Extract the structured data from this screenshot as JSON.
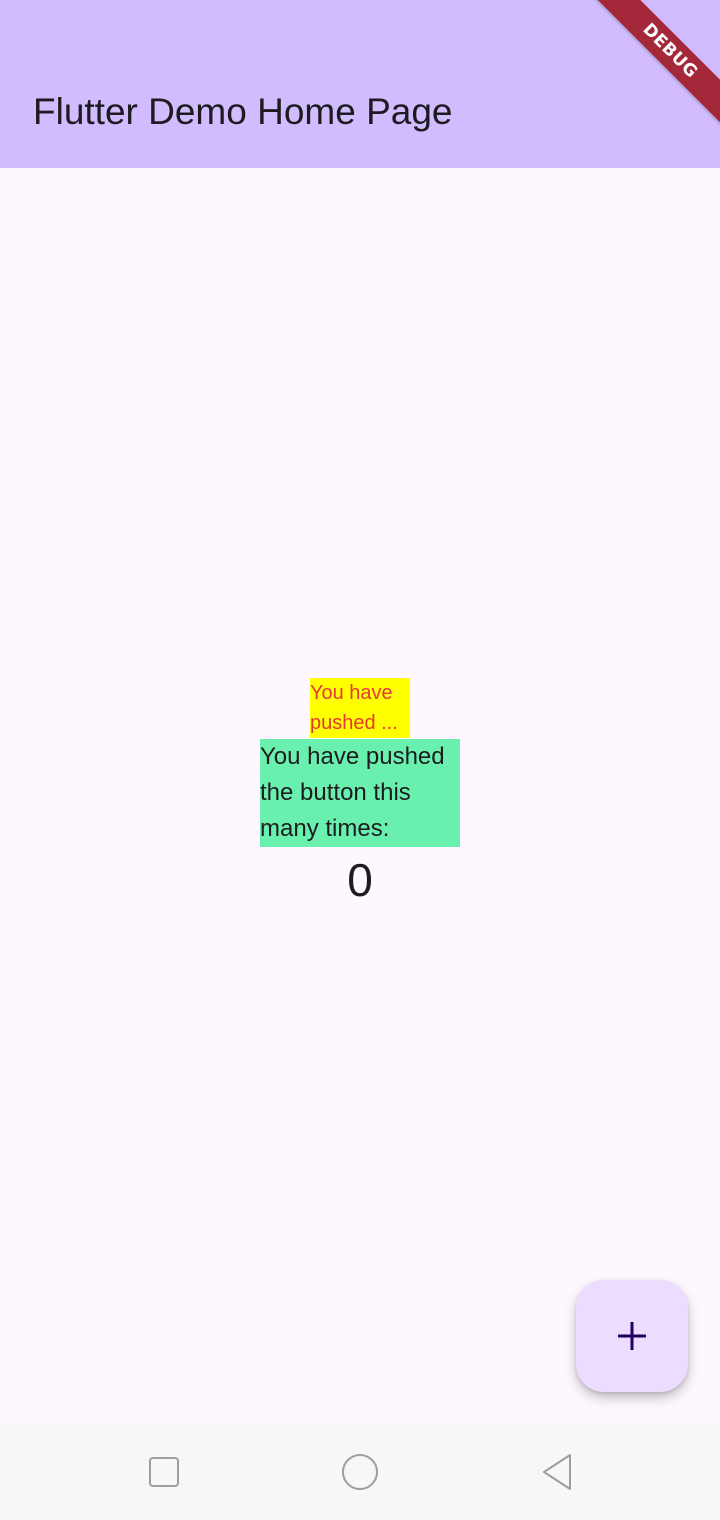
{
  "app_bar": {
    "title": "Flutter Demo Home Page",
    "background": "#d1bcff"
  },
  "debug_banner": {
    "label": "DEBUG",
    "color": "#a5283a"
  },
  "main": {
    "yellow_text": "You have pushed ...",
    "green_text": "You have pushed the button this many times:",
    "counter": "0"
  },
  "fab": {
    "icon": "plus-icon"
  },
  "nav_bar": {
    "icons": [
      "square-recents-icon",
      "circle-home-icon",
      "triangle-back-icon"
    ]
  }
}
